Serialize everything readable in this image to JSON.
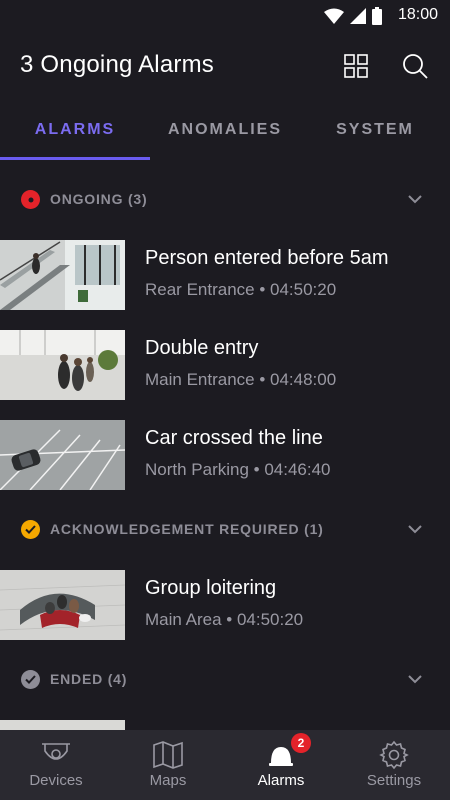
{
  "status_bar": {
    "time": "18:00",
    "icons": [
      "wifi-icon",
      "signal-icon",
      "battery-icon"
    ]
  },
  "app_bar": {
    "title": "3 Ongoing Alarms",
    "actions": [
      "grid-view-icon",
      "search-icon"
    ]
  },
  "tabs": [
    {
      "label": "ALARMS",
      "active": true
    },
    {
      "label": "ANOMALIES",
      "active": false
    },
    {
      "label": "SYSTEM",
      "active": false
    }
  ],
  "sections": [
    {
      "label": "ONGOING (3)",
      "status_color": "#e4232a",
      "icon": "ongoing-dot-icon",
      "items": [
        {
          "title": "Person entered before 5am",
          "subtitle": "Rear Entrance • 04:50:20",
          "thumbnail": "staircase-camera-thumbnail"
        },
        {
          "title": "Double entry",
          "subtitle": "Main Entrance • 04:48:00",
          "thumbnail": "lobby-camera-thumbnail"
        },
        {
          "title": "Car crossed the line",
          "subtitle": "North Parking • 04:46:40",
          "thumbnail": "parking-camera-thumbnail"
        }
      ]
    },
    {
      "label": "ACKNOWLEDGEMENT REQUIRED (1)",
      "status_color": "#f5a800",
      "icon": "check-circle-icon",
      "items": [
        {
          "title": "Group loitering",
          "subtitle": "Main Area • 04:50:20",
          "thumbnail": "lounge-camera-thumbnail"
        }
      ]
    },
    {
      "label": "ENDED (4)",
      "status_color": "#8e8d97",
      "icon": "check-circle-icon",
      "items": []
    }
  ],
  "bottom_nav": [
    {
      "label": "Devices",
      "icon": "camera-dome-icon",
      "active": false
    },
    {
      "label": "Maps",
      "icon": "map-icon",
      "active": false
    },
    {
      "label": "Alarms",
      "icon": "alarm-bell-icon",
      "active": true,
      "badge": "2"
    },
    {
      "label": "Settings",
      "icon": "gear-icon",
      "active": false
    }
  ],
  "colors": {
    "accent": "#6a5cf0",
    "background": "#1c1b21",
    "nav_background": "#2a2930"
  }
}
